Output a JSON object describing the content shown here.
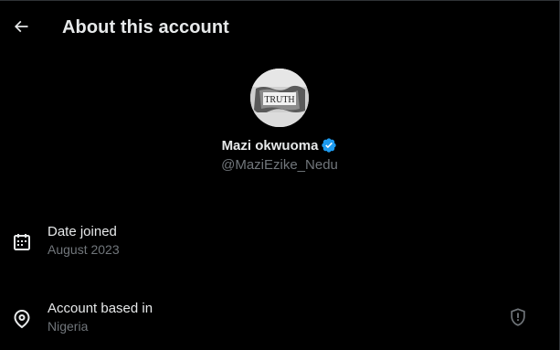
{
  "header": {
    "back_icon": "arrow-left-icon",
    "title": "About this account"
  },
  "profile": {
    "avatar_icon": "truth-avatar",
    "avatar_text": "TRUTH",
    "name": "Mazi okwuoma",
    "verified_icon": "verified-badge-icon",
    "verified_color": "#1d9bf0",
    "handle": "@MaziEzike_Nedu"
  },
  "details": {
    "joined": {
      "icon": "calendar-icon",
      "label": "Date joined",
      "value": "August 2023"
    },
    "location": {
      "icon": "location-pin-icon",
      "label": "Account based in",
      "value": "Nigeria",
      "action_icon": "shield-info-icon"
    }
  },
  "colors": {
    "background": "#000000",
    "primary_text": "#e7e9ea",
    "secondary_text": "#71767b",
    "divider": "#2f3336"
  }
}
